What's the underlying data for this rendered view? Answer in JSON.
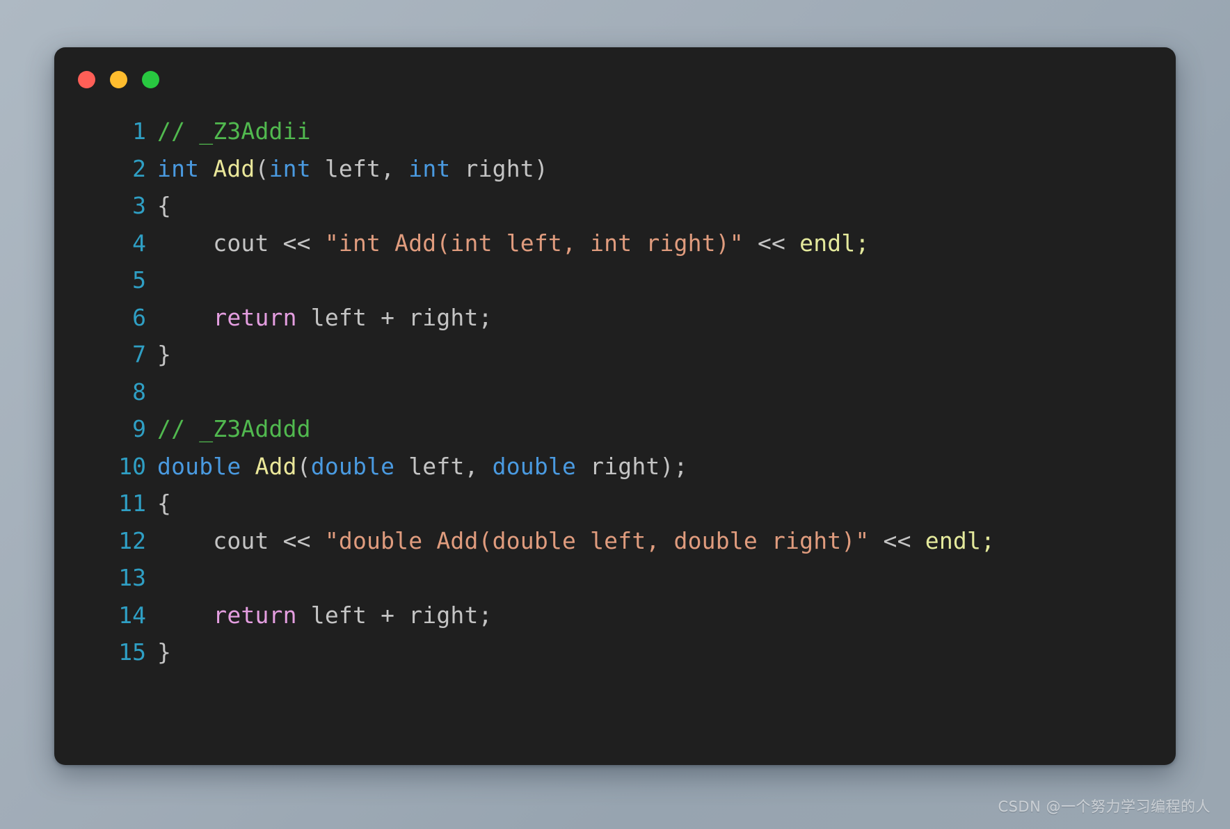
{
  "window": {
    "background_color": "#1f1f1f",
    "controls": [
      {
        "name": "close",
        "color": "#ff5f57"
      },
      {
        "name": "minimize",
        "color": "#febc2e"
      },
      {
        "name": "maximize",
        "color": "#28c840"
      }
    ]
  },
  "theme": {
    "page_gradient_start": "#aeb9c3",
    "page_gradient_end": "#97a4b0",
    "line_number_color": "#2f9fc4",
    "comment_color": "#51b94f",
    "keyword_color": "#4a9ae0",
    "function_color": "#eae79a",
    "string_color": "#e09c7e",
    "plain_color": "#c4c4c4",
    "control_keyword_color": "#e49ee0",
    "identifier_color": "#e4e99c"
  },
  "editor": {
    "language": "cpp",
    "lines": [
      {
        "number": "1",
        "text": "// _Z3Addii",
        "tokens": [
          {
            "t": "// _Z3Addii",
            "c": "t-comment"
          }
        ]
      },
      {
        "number": "2",
        "text": "int Add(int left, int right)",
        "tokens": [
          {
            "t": "int",
            "c": "t-kw"
          },
          {
            "t": " ",
            "c": "t-plain"
          },
          {
            "t": "Add",
            "c": "t-fn"
          },
          {
            "t": "(",
            "c": "t-punct"
          },
          {
            "t": "int",
            "c": "t-kw"
          },
          {
            "t": " left, ",
            "c": "t-plain"
          },
          {
            "t": "int",
            "c": "t-kw"
          },
          {
            "t": " right)",
            "c": "t-plain"
          }
        ]
      },
      {
        "number": "3",
        "text": "{",
        "tokens": [
          {
            "t": "{",
            "c": "t-punct"
          }
        ]
      },
      {
        "number": "4",
        "text": "    cout << \"int Add(int left, int right)\" << endl;",
        "tokens": [
          {
            "t": "    cout ",
            "c": "t-plain"
          },
          {
            "t": "<<",
            "c": "t-op"
          },
          {
            "t": " ",
            "c": "t-plain"
          },
          {
            "t": "\"int Add(int left, int right)\"",
            "c": "t-string"
          },
          {
            "t": " ",
            "c": "t-plain"
          },
          {
            "t": "<<",
            "c": "t-op"
          },
          {
            "t": " ",
            "c": "t-plain"
          },
          {
            "t": "endl",
            "c": "t-id"
          },
          {
            "t": ";",
            "c": "t-id"
          }
        ]
      },
      {
        "number": "5",
        "text": "",
        "tokens": []
      },
      {
        "number": "6",
        "text": "    return left + right;",
        "tokens": [
          {
            "t": "    ",
            "c": "t-plain"
          },
          {
            "t": "return",
            "c": "t-ctrl"
          },
          {
            "t": " left + right;",
            "c": "t-plain"
          }
        ]
      },
      {
        "number": "7",
        "text": "}",
        "tokens": [
          {
            "t": "}",
            "c": "t-punct"
          }
        ]
      },
      {
        "number": "8",
        "text": "",
        "tokens": []
      },
      {
        "number": "9",
        "text": "// _Z3Adddd",
        "tokens": [
          {
            "t": "// _Z3Adddd",
            "c": "t-comment"
          }
        ]
      },
      {
        "number": "10",
        "text": "double Add(double left, double right);",
        "tokens": [
          {
            "t": "double",
            "c": "t-kw"
          },
          {
            "t": " ",
            "c": "t-plain"
          },
          {
            "t": "Add",
            "c": "t-fn"
          },
          {
            "t": "(",
            "c": "t-punct"
          },
          {
            "t": "double",
            "c": "t-kw"
          },
          {
            "t": " left, ",
            "c": "t-plain"
          },
          {
            "t": "double",
            "c": "t-kw"
          },
          {
            "t": " right);",
            "c": "t-plain"
          }
        ]
      },
      {
        "number": "11",
        "text": "{",
        "tokens": [
          {
            "t": "{",
            "c": "t-punct"
          }
        ]
      },
      {
        "number": "12",
        "text": "    cout << \"double Add(double left, double right)\" << endl;",
        "tokens": [
          {
            "t": "    cout ",
            "c": "t-plain"
          },
          {
            "t": "<<",
            "c": "t-op"
          },
          {
            "t": " ",
            "c": "t-plain"
          },
          {
            "t": "\"double Add(double left, double right)\"",
            "c": "t-string"
          },
          {
            "t": " ",
            "c": "t-plain"
          },
          {
            "t": "<<",
            "c": "t-op"
          },
          {
            "t": " ",
            "c": "t-plain"
          },
          {
            "t": "endl",
            "c": "t-id"
          },
          {
            "t": ";",
            "c": "t-id"
          }
        ]
      },
      {
        "number": "13",
        "text": "",
        "tokens": []
      },
      {
        "number": "14",
        "text": "    return left + right;",
        "tokens": [
          {
            "t": "    ",
            "c": "t-plain"
          },
          {
            "t": "return",
            "c": "t-ctrl"
          },
          {
            "t": " left + right;",
            "c": "t-plain"
          }
        ]
      },
      {
        "number": "15",
        "text": "}",
        "tokens": [
          {
            "t": "}",
            "c": "t-punct"
          }
        ]
      }
    ]
  },
  "watermark": {
    "text": "CSDN @一个努力学习编程的人"
  }
}
